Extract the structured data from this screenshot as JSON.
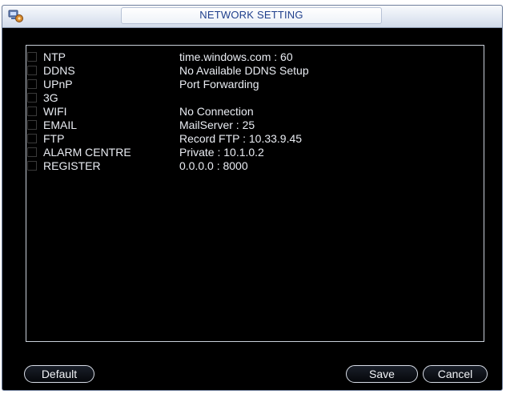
{
  "window": {
    "title": "NETWORK SETTING",
    "icon": "network-settings-icon"
  },
  "services": [
    {
      "label": "NTP",
      "value": "time.windows.com : 60",
      "checked": false
    },
    {
      "label": "DDNS",
      "value": "No Available DDNS Setup",
      "checked": false
    },
    {
      "label": "UPnP",
      "value": "Port Forwarding",
      "checked": false
    },
    {
      "label": "3G",
      "value": "",
      "checked": false
    },
    {
      "label": "WIFI",
      "value": "No Connection",
      "checked": false
    },
    {
      "label": "EMAIL",
      "value": "MailServer : 25",
      "checked": false
    },
    {
      "label": "FTP",
      "value": "Record FTP : 10.33.9.45",
      "checked": false
    },
    {
      "label": "ALARM CENTRE",
      "value": "Private : 10.1.0.2",
      "checked": false
    },
    {
      "label": "REGISTER",
      "value": "0.0.0.0 : 8000",
      "checked": false
    }
  ],
  "buttons": {
    "default_label": "Default",
    "save_label": "Save",
    "cancel_label": "Cancel"
  },
  "colors": {
    "background": "#000000",
    "text": "#e9ecf2",
    "title_text": "#1f3f8c",
    "titlebar": "#e3e9f3"
  }
}
